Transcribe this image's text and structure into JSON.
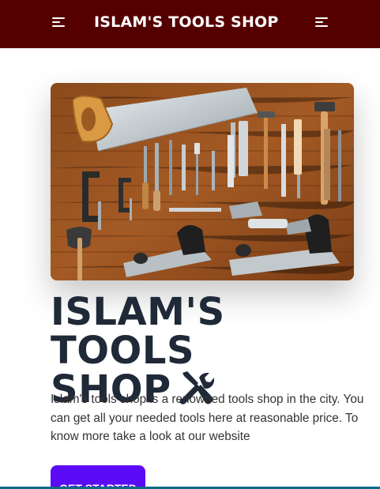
{
  "navbar": {
    "brand": "ISLAM'S TOOLS SHOP",
    "background": "#550000"
  },
  "hero": {
    "title_line1": "ISLAM'S TOOLS",
    "title_line2": "SHOP",
    "title_icon": "tools-icon",
    "description": "Islam's tools shop is a renowned tools shop in the city. You can get all your needed tools here at reasonable price. To know more take a look at our website",
    "cta_label": "GET STARTED",
    "cta_color": "#5b0bf5"
  },
  "icons": {
    "left_menu": "menu-icon",
    "right_menu": "menu-icon"
  }
}
